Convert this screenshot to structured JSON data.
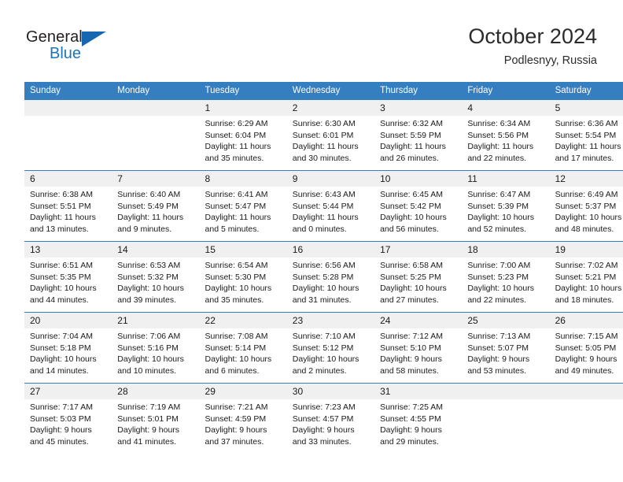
{
  "brand": {
    "name_top": "General",
    "name_bottom": "Blue",
    "triangle_color": "#1667b2",
    "blue_color": "#1b75bb"
  },
  "header": {
    "title": "October 2024",
    "subtitle": "Podlesnyy, Russia"
  },
  "theme": {
    "header_bg": "#357ec0",
    "header_text": "#ffffff",
    "daynum_bg": "#f0f0f0",
    "grid_line": "#357ec0"
  },
  "weekday_headers": [
    "Sunday",
    "Monday",
    "Tuesday",
    "Wednesday",
    "Thursday",
    "Friday",
    "Saturday"
  ],
  "weeks": [
    [
      {
        "day": "",
        "sunrise": "",
        "sunset": "",
        "daylight_1": "",
        "daylight_2": "",
        "empty": true
      },
      {
        "day": "",
        "sunrise": "",
        "sunset": "",
        "daylight_1": "",
        "daylight_2": "",
        "empty": true
      },
      {
        "day": "1",
        "sunrise": "Sunrise: 6:29 AM",
        "sunset": "Sunset: 6:04 PM",
        "daylight_1": "Daylight: 11 hours",
        "daylight_2": "and 35 minutes."
      },
      {
        "day": "2",
        "sunrise": "Sunrise: 6:30 AM",
        "sunset": "Sunset: 6:01 PM",
        "daylight_1": "Daylight: 11 hours",
        "daylight_2": "and 30 minutes."
      },
      {
        "day": "3",
        "sunrise": "Sunrise: 6:32 AM",
        "sunset": "Sunset: 5:59 PM",
        "daylight_1": "Daylight: 11 hours",
        "daylight_2": "and 26 minutes."
      },
      {
        "day": "4",
        "sunrise": "Sunrise: 6:34 AM",
        "sunset": "Sunset: 5:56 PM",
        "daylight_1": "Daylight: 11 hours",
        "daylight_2": "and 22 minutes."
      },
      {
        "day": "5",
        "sunrise": "Sunrise: 6:36 AM",
        "sunset": "Sunset: 5:54 PM",
        "daylight_1": "Daylight: 11 hours",
        "daylight_2": "and 17 minutes."
      }
    ],
    [
      {
        "day": "6",
        "sunrise": "Sunrise: 6:38 AM",
        "sunset": "Sunset: 5:51 PM",
        "daylight_1": "Daylight: 11 hours",
        "daylight_2": "and 13 minutes."
      },
      {
        "day": "7",
        "sunrise": "Sunrise: 6:40 AM",
        "sunset": "Sunset: 5:49 PM",
        "daylight_1": "Daylight: 11 hours",
        "daylight_2": "and 9 minutes."
      },
      {
        "day": "8",
        "sunrise": "Sunrise: 6:41 AM",
        "sunset": "Sunset: 5:47 PM",
        "daylight_1": "Daylight: 11 hours",
        "daylight_2": "and 5 minutes."
      },
      {
        "day": "9",
        "sunrise": "Sunrise: 6:43 AM",
        "sunset": "Sunset: 5:44 PM",
        "daylight_1": "Daylight: 11 hours",
        "daylight_2": "and 0 minutes."
      },
      {
        "day": "10",
        "sunrise": "Sunrise: 6:45 AM",
        "sunset": "Sunset: 5:42 PM",
        "daylight_1": "Daylight: 10 hours",
        "daylight_2": "and 56 minutes."
      },
      {
        "day": "11",
        "sunrise": "Sunrise: 6:47 AM",
        "sunset": "Sunset: 5:39 PM",
        "daylight_1": "Daylight: 10 hours",
        "daylight_2": "and 52 minutes."
      },
      {
        "day": "12",
        "sunrise": "Sunrise: 6:49 AM",
        "sunset": "Sunset: 5:37 PM",
        "daylight_1": "Daylight: 10 hours",
        "daylight_2": "and 48 minutes."
      }
    ],
    [
      {
        "day": "13",
        "sunrise": "Sunrise: 6:51 AM",
        "sunset": "Sunset: 5:35 PM",
        "daylight_1": "Daylight: 10 hours",
        "daylight_2": "and 44 minutes."
      },
      {
        "day": "14",
        "sunrise": "Sunrise: 6:53 AM",
        "sunset": "Sunset: 5:32 PM",
        "daylight_1": "Daylight: 10 hours",
        "daylight_2": "and 39 minutes."
      },
      {
        "day": "15",
        "sunrise": "Sunrise: 6:54 AM",
        "sunset": "Sunset: 5:30 PM",
        "daylight_1": "Daylight: 10 hours",
        "daylight_2": "and 35 minutes."
      },
      {
        "day": "16",
        "sunrise": "Sunrise: 6:56 AM",
        "sunset": "Sunset: 5:28 PM",
        "daylight_1": "Daylight: 10 hours",
        "daylight_2": "and 31 minutes."
      },
      {
        "day": "17",
        "sunrise": "Sunrise: 6:58 AM",
        "sunset": "Sunset: 5:25 PM",
        "daylight_1": "Daylight: 10 hours",
        "daylight_2": "and 27 minutes."
      },
      {
        "day": "18",
        "sunrise": "Sunrise: 7:00 AM",
        "sunset": "Sunset: 5:23 PM",
        "daylight_1": "Daylight: 10 hours",
        "daylight_2": "and 22 minutes."
      },
      {
        "day": "19",
        "sunrise": "Sunrise: 7:02 AM",
        "sunset": "Sunset: 5:21 PM",
        "daylight_1": "Daylight: 10 hours",
        "daylight_2": "and 18 minutes."
      }
    ],
    [
      {
        "day": "20",
        "sunrise": "Sunrise: 7:04 AM",
        "sunset": "Sunset: 5:18 PM",
        "daylight_1": "Daylight: 10 hours",
        "daylight_2": "and 14 minutes."
      },
      {
        "day": "21",
        "sunrise": "Sunrise: 7:06 AM",
        "sunset": "Sunset: 5:16 PM",
        "daylight_1": "Daylight: 10 hours",
        "daylight_2": "and 10 minutes."
      },
      {
        "day": "22",
        "sunrise": "Sunrise: 7:08 AM",
        "sunset": "Sunset: 5:14 PM",
        "daylight_1": "Daylight: 10 hours",
        "daylight_2": "and 6 minutes."
      },
      {
        "day": "23",
        "sunrise": "Sunrise: 7:10 AM",
        "sunset": "Sunset: 5:12 PM",
        "daylight_1": "Daylight: 10 hours",
        "daylight_2": "and 2 minutes."
      },
      {
        "day": "24",
        "sunrise": "Sunrise: 7:12 AM",
        "sunset": "Sunset: 5:10 PM",
        "daylight_1": "Daylight: 9 hours",
        "daylight_2": "and 58 minutes."
      },
      {
        "day": "25",
        "sunrise": "Sunrise: 7:13 AM",
        "sunset": "Sunset: 5:07 PM",
        "daylight_1": "Daylight: 9 hours",
        "daylight_2": "and 53 minutes."
      },
      {
        "day": "26",
        "sunrise": "Sunrise: 7:15 AM",
        "sunset": "Sunset: 5:05 PM",
        "daylight_1": "Daylight: 9 hours",
        "daylight_2": "and 49 minutes."
      }
    ],
    [
      {
        "day": "27",
        "sunrise": "Sunrise: 7:17 AM",
        "sunset": "Sunset: 5:03 PM",
        "daylight_1": "Daylight: 9 hours",
        "daylight_2": "and 45 minutes."
      },
      {
        "day": "28",
        "sunrise": "Sunrise: 7:19 AM",
        "sunset": "Sunset: 5:01 PM",
        "daylight_1": "Daylight: 9 hours",
        "daylight_2": "and 41 minutes."
      },
      {
        "day": "29",
        "sunrise": "Sunrise: 7:21 AM",
        "sunset": "Sunset: 4:59 PM",
        "daylight_1": "Daylight: 9 hours",
        "daylight_2": "and 37 minutes."
      },
      {
        "day": "30",
        "sunrise": "Sunrise: 7:23 AM",
        "sunset": "Sunset: 4:57 PM",
        "daylight_1": "Daylight: 9 hours",
        "daylight_2": "and 33 minutes."
      },
      {
        "day": "31",
        "sunrise": "Sunrise: 7:25 AM",
        "sunset": "Sunset: 4:55 PM",
        "daylight_1": "Daylight: 9 hours",
        "daylight_2": "and 29 minutes."
      },
      {
        "day": "",
        "sunrise": "",
        "sunset": "",
        "daylight_1": "",
        "daylight_2": "",
        "empty": true
      },
      {
        "day": "",
        "sunrise": "",
        "sunset": "",
        "daylight_1": "",
        "daylight_2": "",
        "empty": true
      }
    ]
  ]
}
